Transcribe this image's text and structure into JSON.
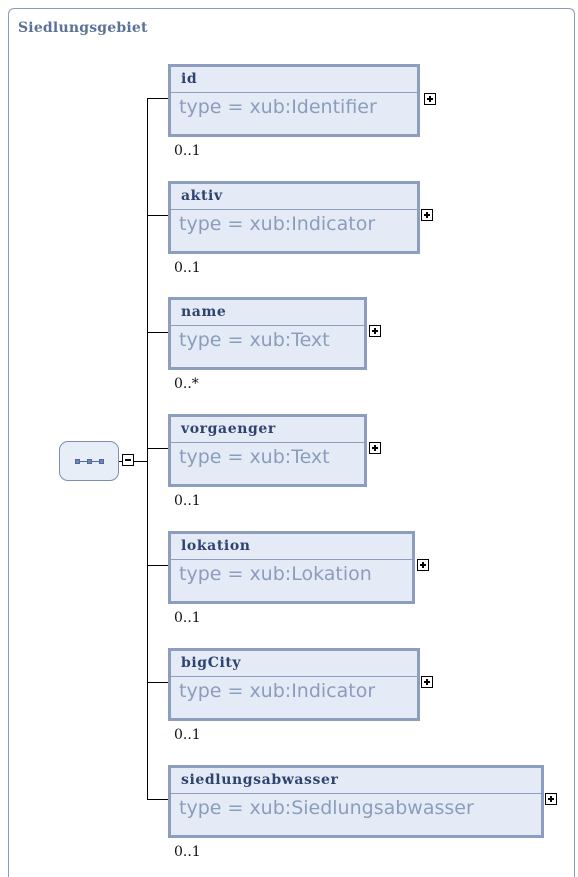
{
  "group_title": "Siedlungsgebiet",
  "elements": [
    {
      "name": "id",
      "type": "type = xub:Identifier",
      "cardinality": "0..1"
    },
    {
      "name": "aktiv",
      "type": "type = xub:Indicator",
      "cardinality": "0..1"
    },
    {
      "name": "name",
      "type": "type = xub:Text",
      "cardinality": "0..*"
    },
    {
      "name": "vorgaenger",
      "type": "type = xub:Text",
      "cardinality": "0..1"
    },
    {
      "name": "lokation",
      "type": "type = xub:Lokation",
      "cardinality": "0..1"
    },
    {
      "name": "bigCity",
      "type": "type = xub:Indicator",
      "cardinality": "0..1"
    },
    {
      "name": "siedlungsabwasser",
      "type": "type = xub:Siedlungsabwasser",
      "cardinality": "0..1"
    }
  ]
}
